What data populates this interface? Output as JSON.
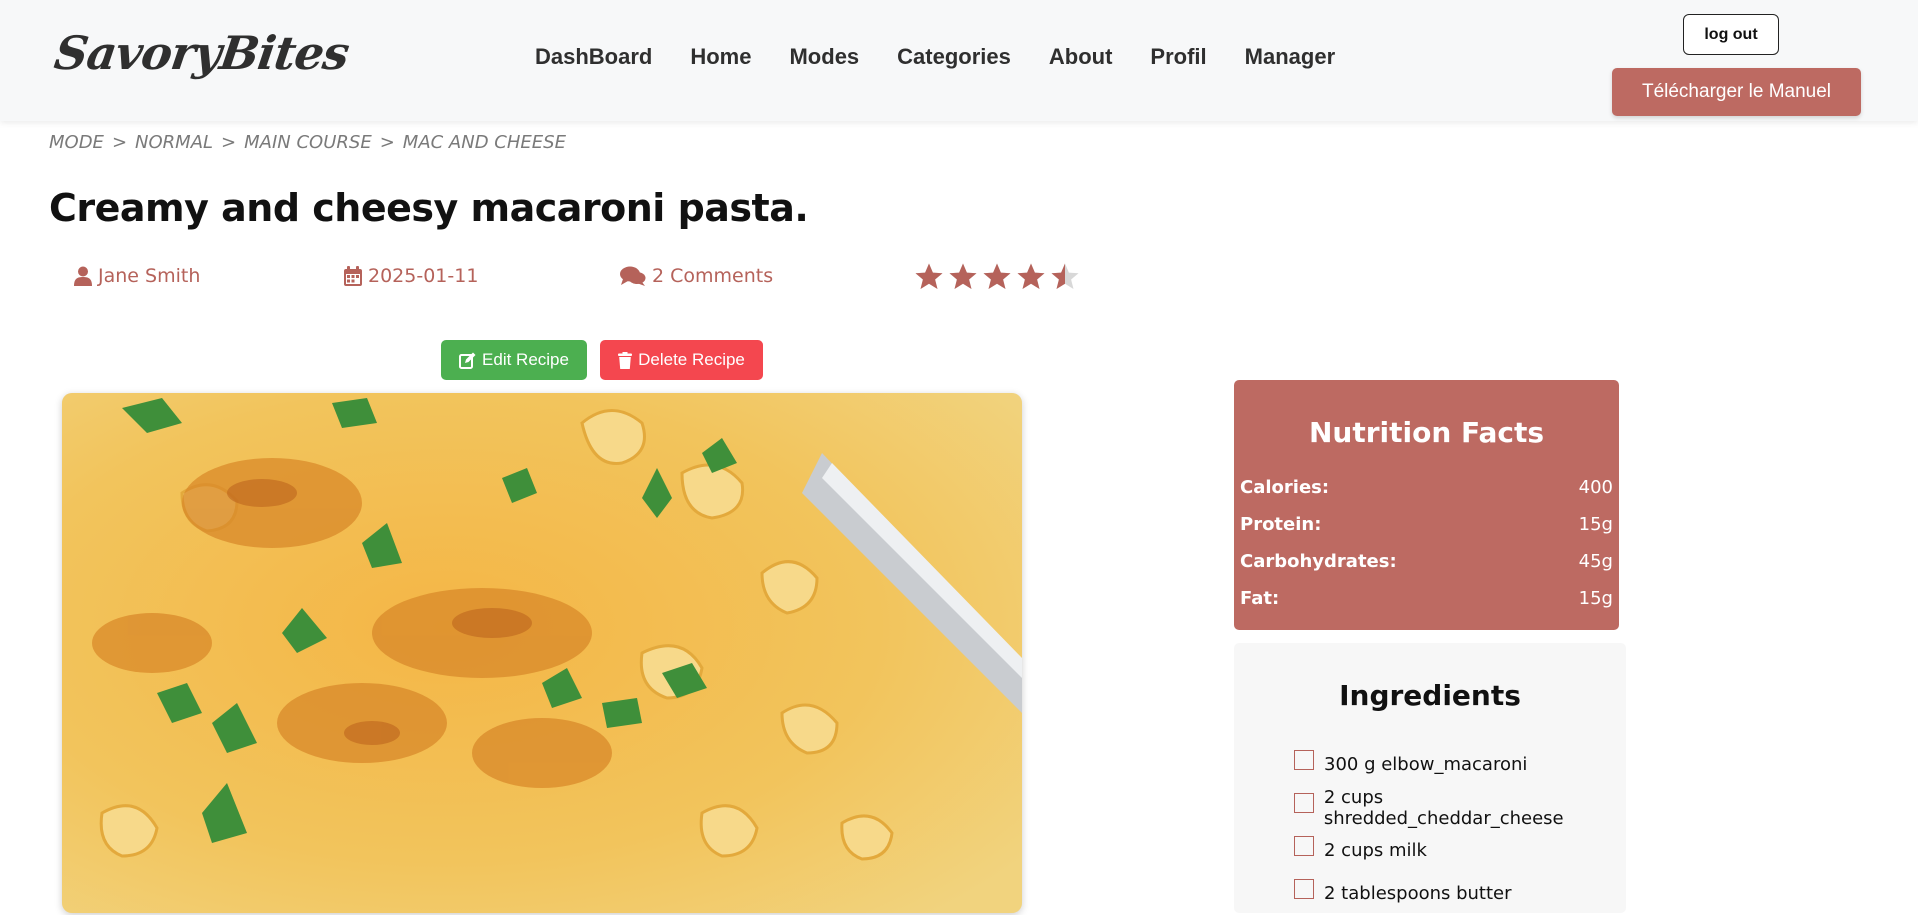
{
  "brand": {
    "logo": "SavoryBites"
  },
  "nav": {
    "items": [
      "DashBoard",
      "Home",
      "Modes",
      "Categories",
      "About",
      "Profil",
      "Manager"
    ]
  },
  "header": {
    "logout_label": "log out",
    "manual_label": "Télécharger le Manuel"
  },
  "breadcrumb": {
    "items": [
      "MODE",
      "NORMAL",
      "MAIN COURSE",
      "MAC AND CHEESE"
    ],
    "separator": ">"
  },
  "recipe": {
    "title": "Creamy and cheesy macaroni pasta.",
    "author": "Jane Smith",
    "date": "2025-01-11",
    "comments": "2 Comments",
    "rating": 4.5,
    "rating_max": 5
  },
  "actions": {
    "edit_label": "Edit Recipe",
    "delete_label": "Delete Recipe"
  },
  "nutrition": {
    "title": "Nutrition Facts",
    "rows": [
      {
        "label": "Calories:",
        "value": "400"
      },
      {
        "label": "Protein:",
        "value": "15g"
      },
      {
        "label": "Carbohydrates:",
        "value": "45g"
      },
      {
        "label": "Fat:",
        "value": "15g"
      }
    ]
  },
  "ingredients": {
    "title": "Ingredients",
    "items": [
      "300 g elbow_macaroni",
      "2 cups shredded_cheddar_cheese",
      "2 cups milk",
      "2 tablespoons butter"
    ]
  },
  "colors": {
    "accent": "#bd6a62",
    "edit": "#4caf50",
    "delete": "#f4474f",
    "star": "#b5625a"
  },
  "icons": {
    "author": "user-icon",
    "date": "calendar-icon",
    "comments": "comments-icon",
    "edit": "edit-icon",
    "delete": "trash-icon"
  }
}
